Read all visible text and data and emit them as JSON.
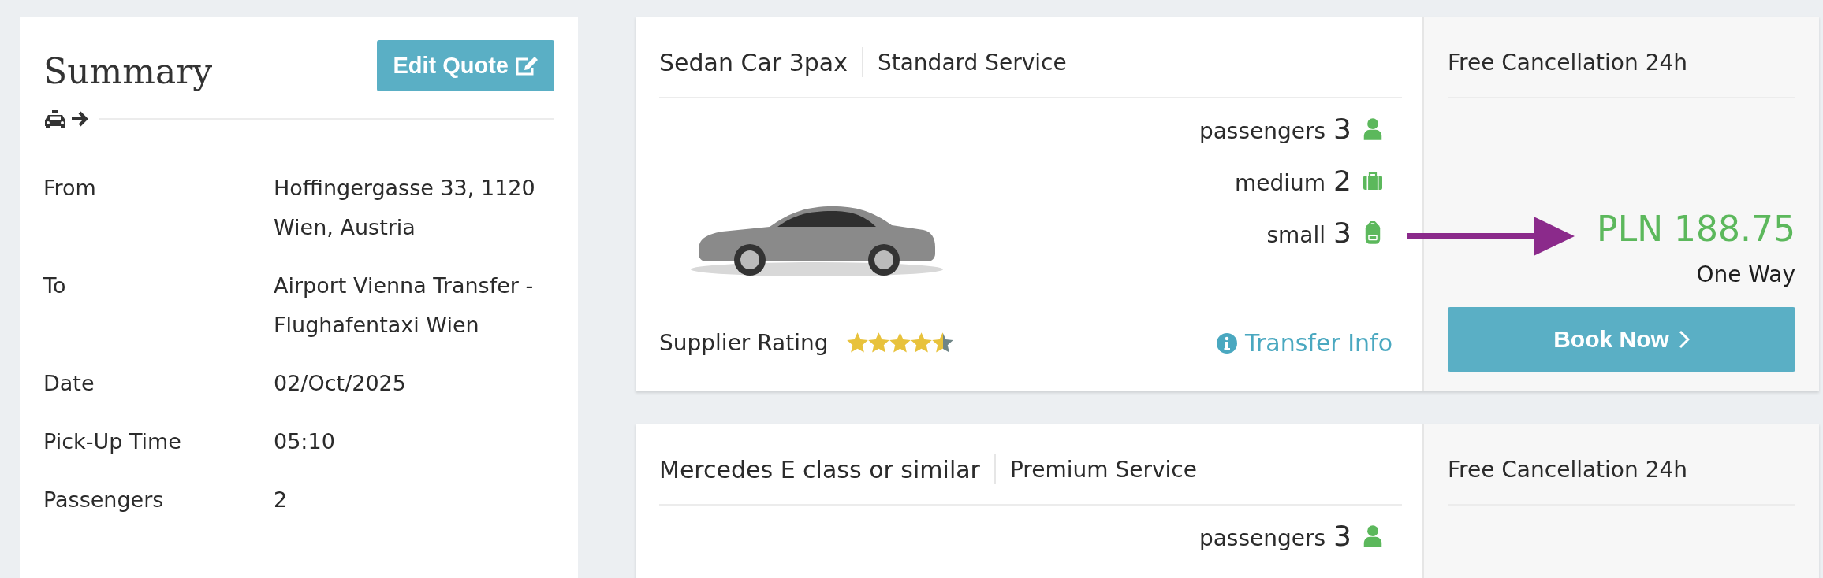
{
  "summary": {
    "title": "Summary",
    "edit_button": "Edit Quote",
    "rows": [
      {
        "label": "From",
        "value": "Hoffingergasse 33, 1120 Wien, Austria"
      },
      {
        "label": "To",
        "value": "Airport Vienna Transfer - Flughafentaxi Wien"
      },
      {
        "label": "Date",
        "value": "02/Oct/2025"
      },
      {
        "label": "Pick-Up Time",
        "value": "05:10"
      },
      {
        "label": "Passengers",
        "value": "2"
      }
    ]
  },
  "offers": [
    {
      "vehicle": "Sedan Car 3pax",
      "service": "Standard Service",
      "cancellation": "Free Cancellation 24h",
      "features": [
        {
          "kind": "person",
          "label": "passengers",
          "count": "3"
        },
        {
          "kind": "suitcase",
          "label": "medium",
          "count": "2"
        },
        {
          "kind": "backpack",
          "label": "small",
          "count": "3"
        }
      ],
      "rating_label": "Supplier Rating",
      "stars": 4.5,
      "info_link": "Transfer Info",
      "price": "PLN 188.75",
      "trip_type": "One Way",
      "book_button": "Book Now"
    },
    {
      "vehicle": "Mercedes E class or similar",
      "service": "Premium Service",
      "cancellation": "Free Cancellation 24h",
      "features": [
        {
          "kind": "person",
          "label": "passengers",
          "count": "3"
        }
      ]
    }
  ]
}
